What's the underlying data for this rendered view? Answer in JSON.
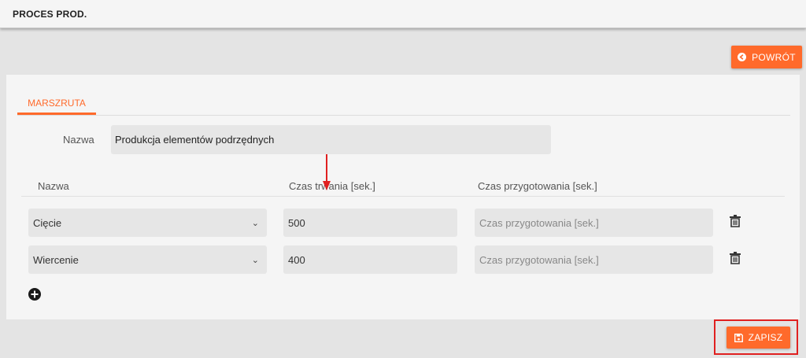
{
  "header": {
    "title": "PROCES PROD."
  },
  "actions": {
    "back_label": "POWRÓT",
    "save_label": "ZAPISZ"
  },
  "tabs": [
    {
      "label": "MARSZRUTA",
      "active": true
    }
  ],
  "form": {
    "name_label": "Nazwa",
    "name_value": "Produkcja elementów podrzędnych"
  },
  "table": {
    "headers": [
      "Nazwa",
      "Czas trwania [sek.]",
      "Czas przygotowania [sek.]"
    ],
    "rows": [
      {
        "operation": "Cięcie",
        "duration": "500",
        "prep_placeholder": "Czas przygotowania [sek.]"
      },
      {
        "operation": "Wiercenie",
        "duration": "400",
        "prep_placeholder": "Czas przygotowania [sek.]"
      }
    ]
  },
  "colors": {
    "accent": "#ff6a2b",
    "annotation": "#e02020"
  },
  "icons": {
    "back": "arrow-circle-left-icon",
    "save": "floppy-disk-icon",
    "delete": "trash-icon",
    "add": "plus-circle-icon",
    "dropdown": "chevron-down-icon"
  }
}
